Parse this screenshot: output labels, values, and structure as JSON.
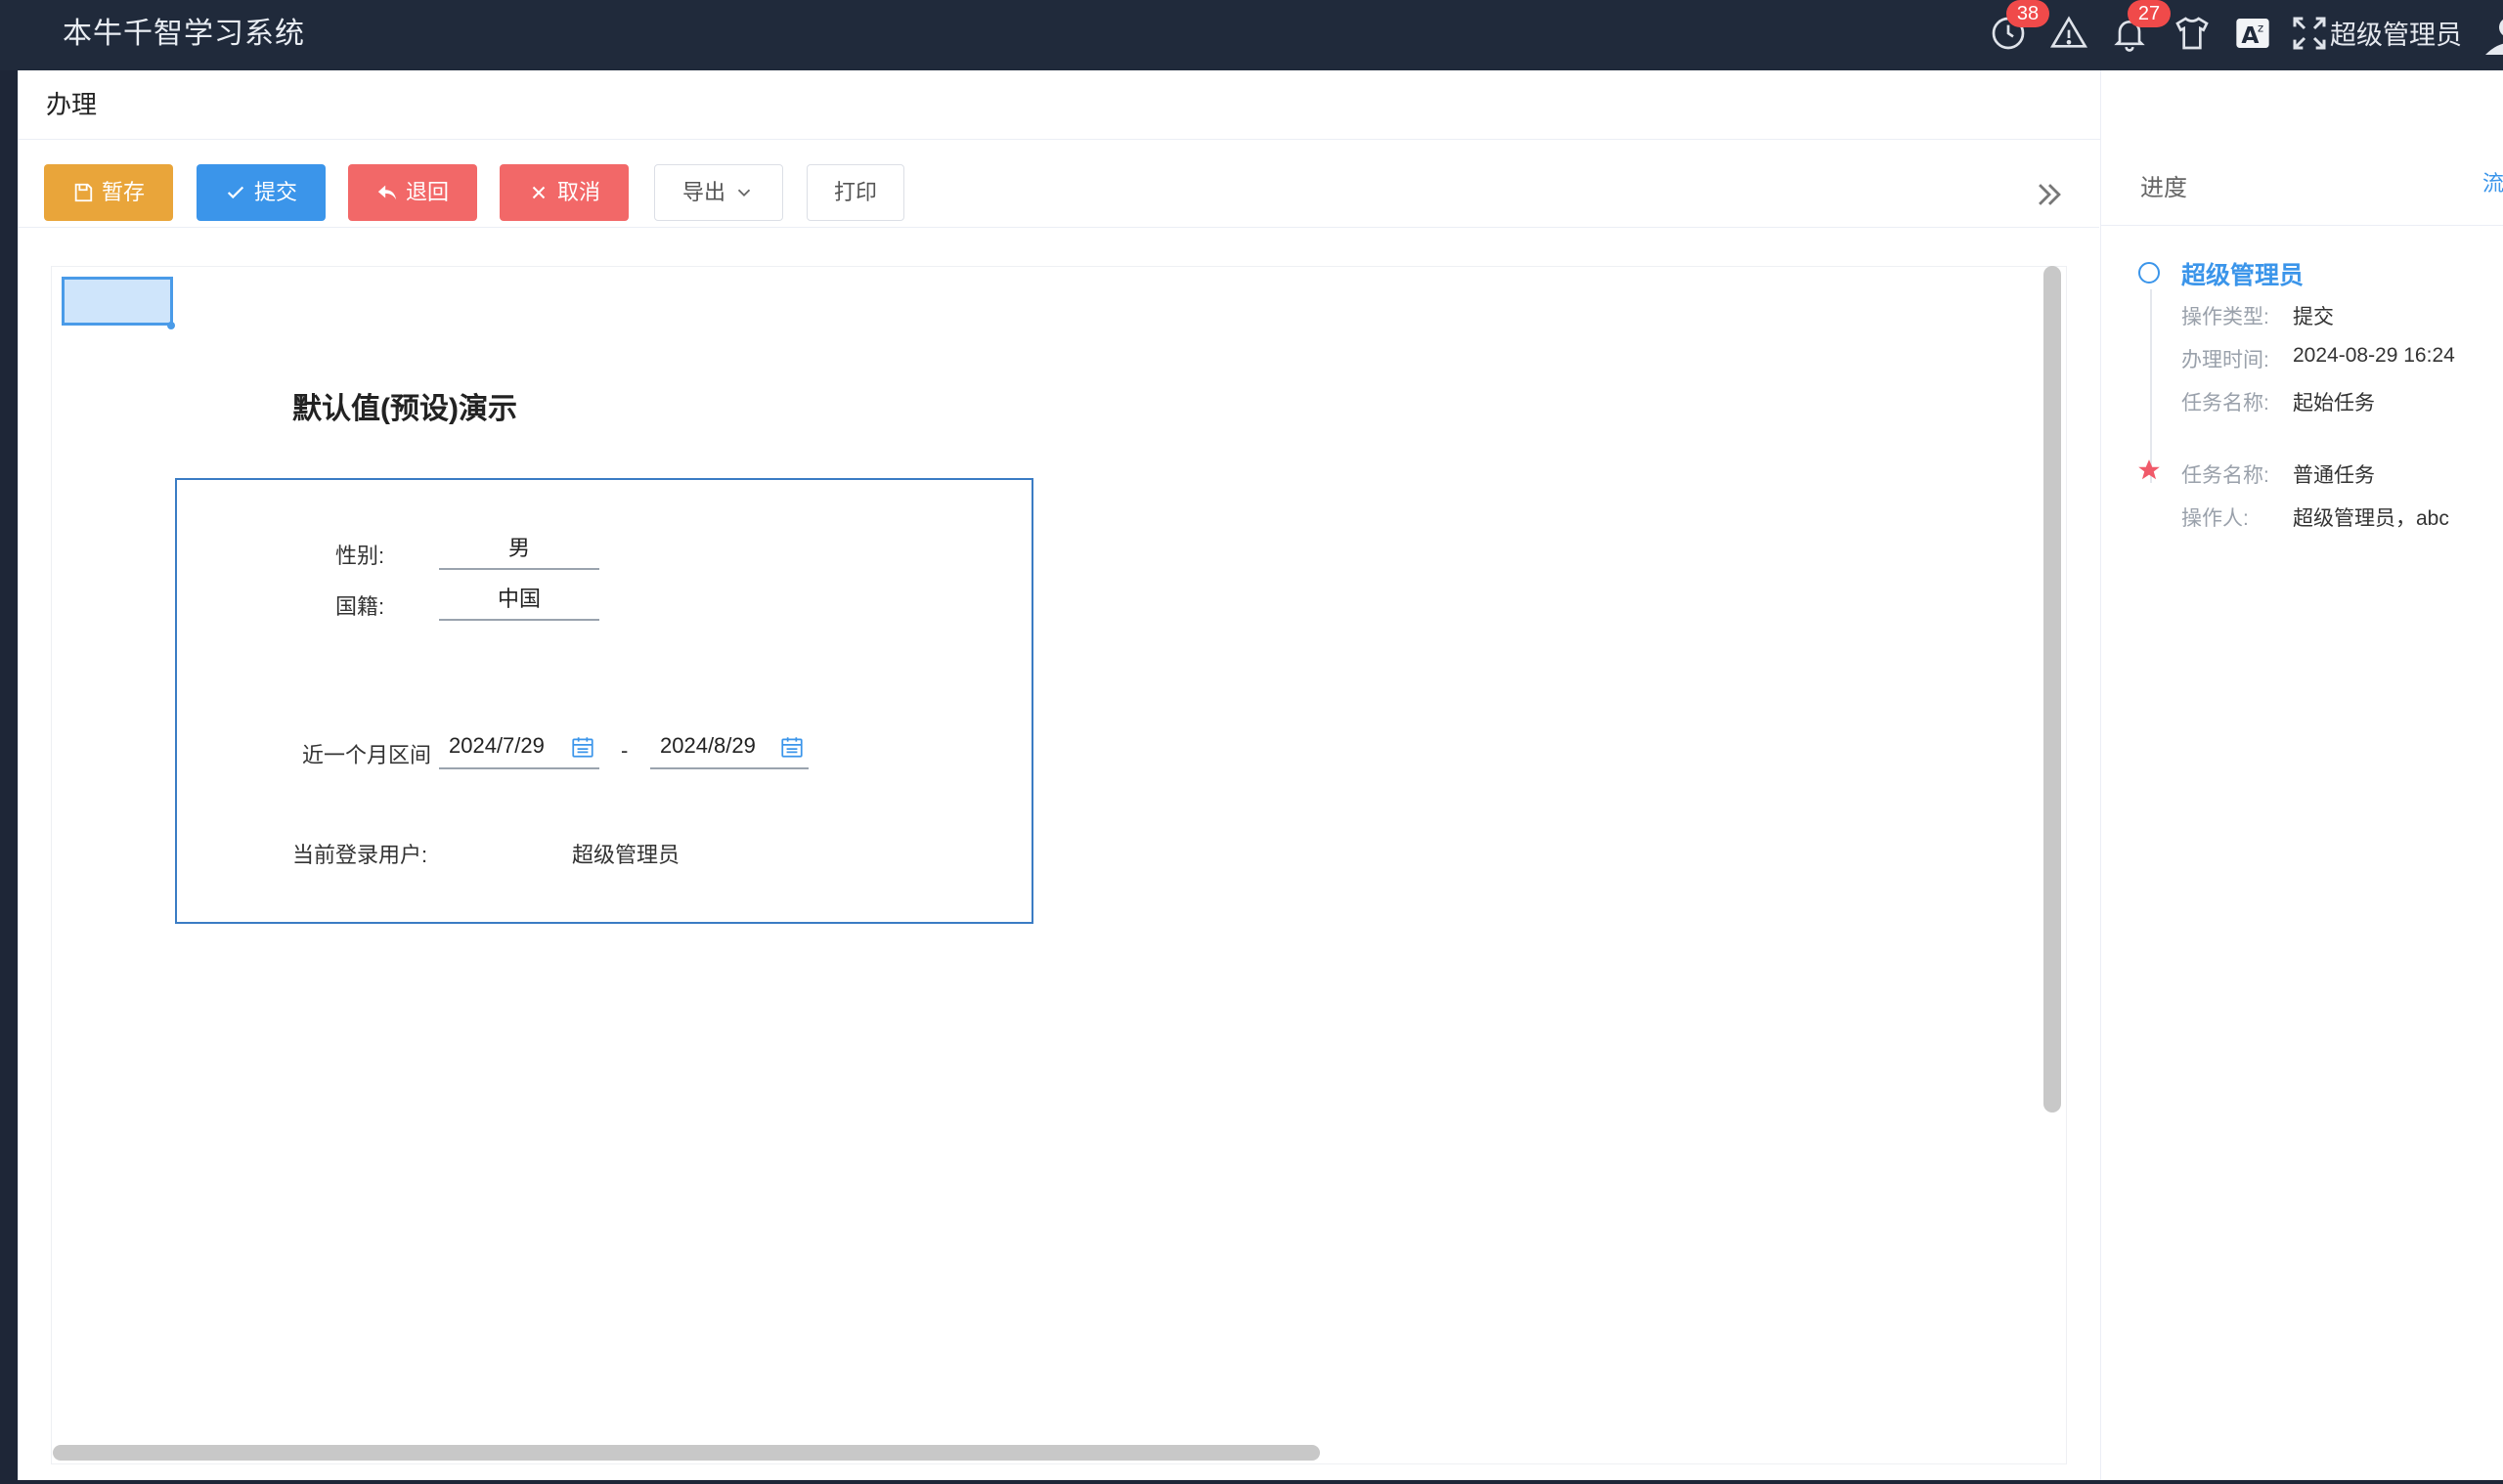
{
  "app": {
    "title": "本牛千智学习系统"
  },
  "header": {
    "clock_badge": "38",
    "bell_badge": "27",
    "user_name": "超级管理员"
  },
  "page": {
    "title": "办理"
  },
  "toolbar": {
    "save_label": "暂存",
    "submit_label": "提交",
    "back_label": "退回",
    "cancel_label": "取消",
    "export_label": "导出",
    "print_label": "打印"
  },
  "form": {
    "heading": "默认值(预设)演示",
    "gender_label": "性别:",
    "gender_value": "男",
    "nationality_label": "国籍:",
    "nationality_value": "中国",
    "range_label": "近一个月区间",
    "range_start": "2024/7/29",
    "range_sep": "-",
    "range_end": "2024/8/29",
    "current_user_label": "当前登录用户:",
    "current_user_value": "超级管理员"
  },
  "progress": {
    "title": "进度",
    "link_label": "流",
    "steps": [
      {
        "name": "超级管理员",
        "op_type_key": "操作类型:",
        "op_type_val": "提交",
        "time_key": "办理时间:",
        "time_val": "2024-08-29 16:24",
        "task_key": "任务名称:",
        "task_val": "起始任务"
      },
      {
        "task_key": "任务名称:",
        "task_val": "普通任务",
        "operator_key": "操作人:",
        "operator_val": "超级管理员，abc"
      }
    ]
  },
  "colors": {
    "topbar": "#202a3b",
    "save": "#e9a53a",
    "submit": "#3b95ea",
    "danger": "#f26868",
    "accent": "#3b95ea"
  }
}
